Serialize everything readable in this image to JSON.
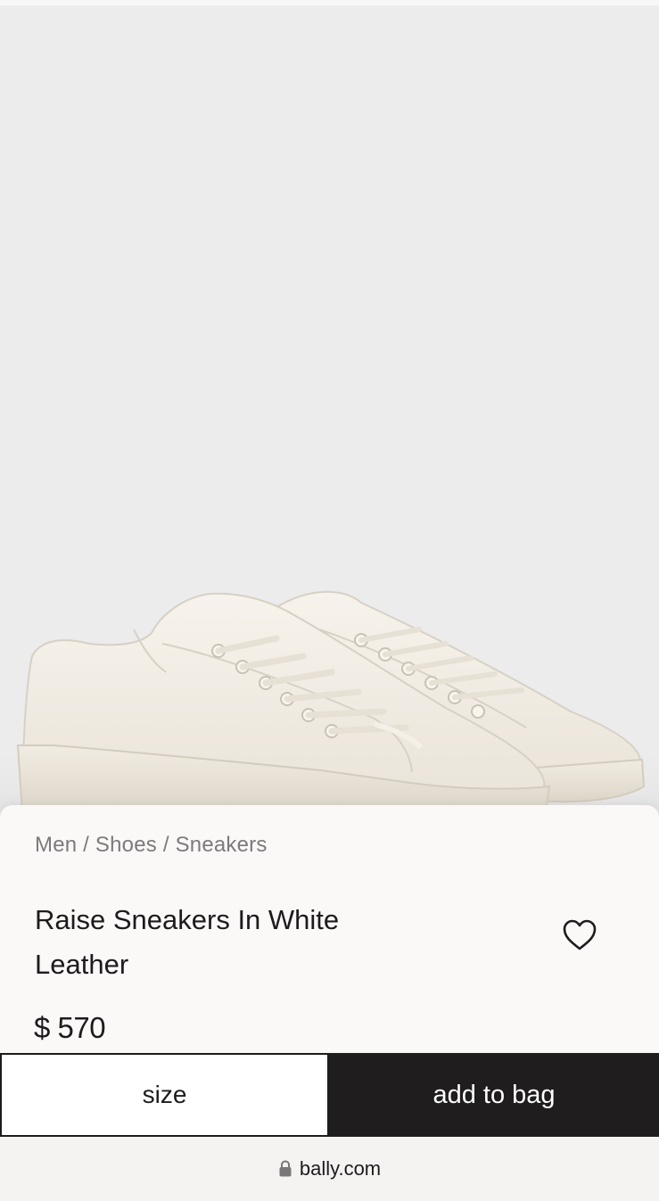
{
  "product": {
    "breadcrumb": [
      "Men",
      "Shoes",
      "Sneakers"
    ],
    "breadcrumb_separator": " / ",
    "title": "Raise Sneakers In White Leather",
    "price": "$ 570",
    "image_alt_icon": "sneaker-image",
    "wishlist_icon": "heart-icon"
  },
  "actions": {
    "size_label": "size",
    "add_label": "add to bag"
  },
  "browser": {
    "domain": "bally.com",
    "lock_icon": "lock-icon"
  },
  "colors": {
    "background": "#ececed",
    "sheet": "#fbf8f8",
    "text": "#1d1b1c",
    "muted": "#7c7a7b",
    "primary_button": "#1f1d1e"
  }
}
